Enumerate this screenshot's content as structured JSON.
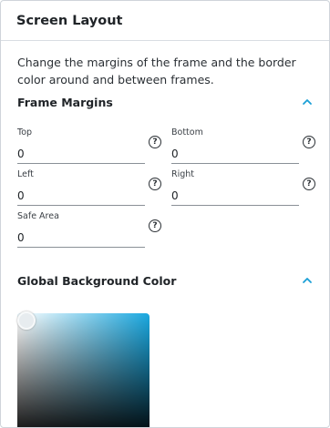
{
  "panel": {
    "title": "Screen Layout",
    "description": "Change the margins of the frame and the border color around and between frames."
  },
  "frame_margins": {
    "title": "Frame Margins",
    "collapse_icon": "chevron-up-icon",
    "fields": {
      "top": {
        "label": "Top",
        "value": "0"
      },
      "bottom": {
        "label": "Bottom",
        "value": "0"
      },
      "left": {
        "label": "Left",
        "value": "0"
      },
      "right": {
        "label": "Right",
        "value": "0"
      },
      "safe_area": {
        "label": "Safe Area",
        "value": "0"
      }
    },
    "help_icon": "help-circle-icon",
    "help_glyph": "?"
  },
  "background_color": {
    "title": "Global Background Color",
    "collapse_icon": "chevron-up-icon",
    "hue_color": "#1aa8e0"
  },
  "colors": {
    "accent": "#1a9fd6",
    "text": "#202428",
    "border": "#cfd4da"
  }
}
